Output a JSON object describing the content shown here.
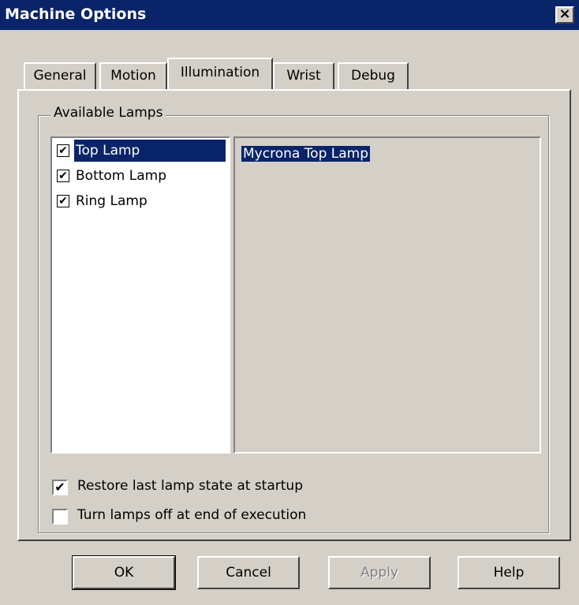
{
  "window": {
    "title": "Machine Options",
    "close_glyph": "✕"
  },
  "tabs": [
    {
      "label": "General",
      "active": false
    },
    {
      "label": "Motion",
      "active": false
    },
    {
      "label": "Illumination",
      "active": true
    },
    {
      "label": "Wrist",
      "active": false
    },
    {
      "label": "Debug",
      "active": false
    }
  ],
  "group": {
    "legend": "Available Lamps",
    "lamps": [
      {
        "label": "Top Lamp",
        "checked": true,
        "selected": true
      },
      {
        "label": "Bottom Lamp",
        "checked": true,
        "selected": false
      },
      {
        "label": "Ring Lamp",
        "checked": true,
        "selected": false
      }
    ],
    "detail_text": "Mycrona Top Lamp"
  },
  "options": [
    {
      "label": "Restore last lamp state at startup",
      "checked": true
    },
    {
      "label": "Turn lamps off at end of execution",
      "checked": false
    }
  ],
  "buttons": {
    "ok": "OK",
    "cancel": "Cancel",
    "apply": "Apply",
    "help": "Help"
  },
  "check_glyph": "✔",
  "colors": {
    "selection": "#0a246a",
    "face": "#d4d0c8"
  }
}
